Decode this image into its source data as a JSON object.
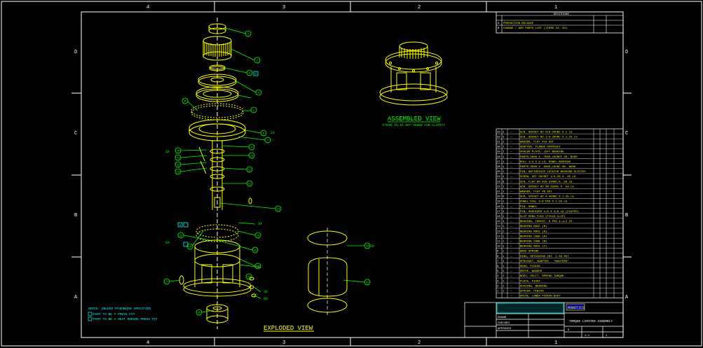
{
  "drawing": {
    "background": "#000000",
    "line_color_white": "#ffffff",
    "line_color_yellow": "#ffff00",
    "line_color_cyan": "#00ffff",
    "line_color_green": "#00ff00"
  },
  "border": {
    "columns": [
      "4",
      "3",
      "2",
      "1"
    ],
    "rows": [
      "D",
      "C",
      "B",
      "A"
    ]
  },
  "views": {
    "exploded_title": "EXPLODED VIEW",
    "assembled_title": "ASSEMBLED VIEW",
    "assembled_note": "ITEMS 10,16 NOT SHOWN FOR CLARITY"
  },
  "balloons": {
    "labels": [
      "1",
      "2",
      "3",
      "4",
      "5",
      "6",
      "7",
      "8",
      "9",
      "10",
      "11",
      "12",
      "13",
      "14",
      "15",
      "16",
      "17",
      "18",
      "19",
      "20",
      "21",
      "22",
      "23",
      "24",
      "25",
      "26",
      "27",
      "28",
      "29",
      "30",
      "31",
      "32",
      "33"
    ],
    "qty_tags": [
      "2X",
      "3X",
      "6X",
      "3X",
      "3X",
      "3X",
      "8X"
    ],
    "special_marks": [
      "P",
      "H"
    ]
  },
  "notes": {
    "heading": "NOTES: UNLESS OTHERWISE SPECIFIED",
    "line_1": "PART TO BE A PRESS FIT",
    "line_2": "PART TO BE A HEAT SHRINK PRESS FIT"
  },
  "revisions": {
    "header": "REVISIONS",
    "rows": [
      {
        "rev": "A",
        "desc": "PRODUCTION RELEASE",
        "date": "",
        "by": ""
      },
      {
        "rev": "B",
        "desc": "CHANGE / ADD PARTS LIST (ITEMS 32, 33)",
        "date": "",
        "by": ""
      }
    ]
  },
  "bom": {
    "rows": [
      {
        "item": "33",
        "qty": "2",
        "part": "—",
        "desc": "SCR, SOCKET HD #10-24UNC X 1 LG"
      },
      {
        "item": "32",
        "qty": "3",
        "part": "—",
        "desc": "SCR, SOCKET HD 1/4-20UNC X 1.75 LG"
      },
      {
        "item": "31",
        "qty": "1",
        "part": "—",
        "desc": "WASHER, FLAT #10 SST"
      },
      {
        "item": "30",
        "qty": "1",
        "part": "—",
        "desc": "ADAPTER, FLANGE-SPROCKET"
      },
      {
        "item": "29",
        "qty": "1",
        "part": "—",
        "desc": "SPACER PLATE, LEFT BEARING"
      },
      {
        "item": "28",
        "qty": "1",
        "part": "—",
        "desc": "PARTS-3000 X .7500-24UNEF GR. BUSH"
      },
      {
        "item": "27",
        "qty": "1",
        "part": "—",
        "desc": "ROLL 1/4 X 2 LG, DOWEL BUSHING"
      },
      {
        "item": "26",
        "qty": "1",
        "part": "—",
        "desc": "PARTS-3000 X .5000-13UNC GR. BUSH"
      },
      {
        "item": "25",
        "qty": "1",
        "part": "—",
        "desc": "PIN, ANTIROTATE LOCATOR BUSHING-SLOTTED"
      },
      {
        "item": "24",
        "qty": "1",
        "part": "—",
        "desc": "SCREW, SET SOCKET 1/4-20 X .25 LG"
      },
      {
        "item": "23",
        "qty": "8",
        "part": "—",
        "desc": "SCR, FLAT HD #10-24UNC X .50 LG"
      },
      {
        "item": "22",
        "qty": "1",
        "part": "—",
        "desc": "SCR, SOCKET HD #8-32UNC X .50 LG"
      },
      {
        "item": "21",
        "qty": "1",
        "part": "—",
        "desc": "WASHER, FLAT #8 SST"
      },
      {
        "item": "20",
        "qty": "6",
        "part": "—",
        "desc": "SCR, SOCKET HD 4-40UNC X 1.25 LG"
      },
      {
        "item": "19",
        "qty": "1",
        "part": "—",
        "desc": "DOWEL PIN, 1/8 DIA X 1.25 LG"
      },
      {
        "item": "18",
        "qty": "1",
        "part": "—",
        "desc": "PIN, DOWEL"
      },
      {
        "item": "17",
        "qty": "2",
        "part": "—",
        "desc": "PIN, SHOULDER 1/8 X 3/8 LG (PLATED)"
      },
      {
        "item": "16",
        "qty": "1",
        "part": "—",
        "desc": "SLIP RING FLEX (FIELD CLIP)"
      },
      {
        "item": "15",
        "qty": "1",
        "part": "—",
        "desc": "BEARING, THRUST, 6 POS 1-1/2 ID"
      },
      {
        "item": "14",
        "qty": "1",
        "part": "—",
        "desc": "BEARING RACE (B)"
      },
      {
        "item": "13",
        "qty": "1",
        "part": "—",
        "desc": "BEARING RACE (A)"
      },
      {
        "item": "12",
        "qty": "1",
        "part": "—",
        "desc": "BEARING CAGE (A)"
      },
      {
        "item": "11",
        "qty": "1",
        "part": "—",
        "desc": "BEARING CAGE (B)"
      },
      {
        "item": "10",
        "qty": "1",
        "part": "—",
        "desc": "BEARING RACE (C)"
      },
      {
        "item": "9",
        "qty": "1",
        "part": "—",
        "desc": "WAVE SPRING"
      },
      {
        "item": "8",
        "qty": "1",
        "part": "—",
        "desc": "RING, RETAINING INT. 1.50 SST"
      },
      {
        "item": "7",
        "qty": "1",
        "part": "—",
        "desc": "SPROCKET, ADAPTER - \"MASTERS\""
      },
      {
        "item": "6",
        "qty": "1",
        "part": "—",
        "desc": "GEAR, PINION"
      },
      {
        "item": "5",
        "qty": "1",
        "part": "—",
        "desc": "DRIVE, WASHER"
      },
      {
        "item": "4",
        "qty": "1",
        "part": "—",
        "desc": "BODY, SPLIT, SPRING TORQUE"
      },
      {
        "item": "3",
        "qty": "1",
        "part": "—",
        "desc": "PLATE, PIVOT"
      },
      {
        "item": "2",
        "qty": "1",
        "part": "—",
        "desc": "HOUSING, BEARING"
      },
      {
        "item": "1",
        "qty": "1",
        "part": "—",
        "desc": "SPACER, PINION"
      },
      {
        "item": "",
        "qty": "",
        "part": "—",
        "desc": "DRIVE, LOWER PINION BODY"
      }
    ],
    "header": "PARTS LIST"
  },
  "title_block": {
    "title": "TORQUE LIMITER ASSEMBLY",
    "company": "ROBOTICS",
    "size": "D",
    "scale": "1:1",
    "sheet": "1",
    "drawn": "DRAWN",
    "checked": "CHECKED",
    "approved": "APPROVED"
  }
}
